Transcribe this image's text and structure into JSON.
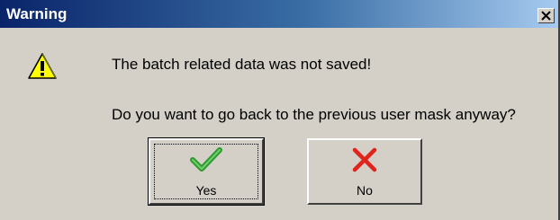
{
  "window": {
    "title": "Warning",
    "close_icon": "close-icon"
  },
  "message": {
    "icon": "warning-triangle-icon",
    "line1": "The batch related data was not saved!",
    "line2": "Do you want to go back to the previous user mask anyway?"
  },
  "buttons": {
    "yes_label": "Yes",
    "yes_icon": "checkmark-icon",
    "no_label": "No",
    "no_icon": "x-mark-icon"
  },
  "colors": {
    "dialog_face": "#d4d0c8",
    "title_gradient_start": "#0a246a",
    "title_gradient_end": "#a6caf0",
    "checkmark": "#2e9a2e",
    "x_mark": "#e0231b",
    "warning_yellow": "#ffff00"
  }
}
